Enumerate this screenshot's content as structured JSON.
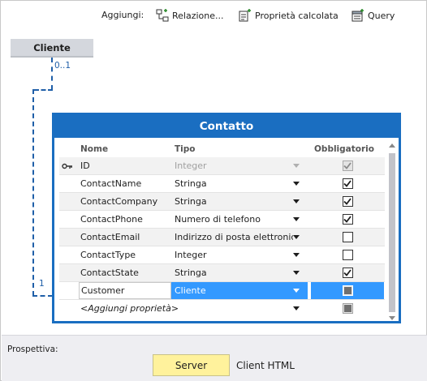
{
  "toolbar": {
    "label": "Aggiungi:",
    "relation_label": "Relazione...",
    "computed_label": "Proprietà calcolata",
    "query_label": "Query"
  },
  "parent_entity": {
    "name": "Cliente",
    "multiplicity_top": "0..1",
    "multiplicity_bottom": "1"
  },
  "entity": {
    "title": "Contatto",
    "columns": {
      "name": "Nome",
      "type": "Tipo",
      "required": "Obbligatorio"
    },
    "rows": [
      {
        "name": "ID",
        "type": "Integer",
        "required": true,
        "key": true,
        "disabled": true
      },
      {
        "name": "ContactName",
        "type": "Stringa",
        "required": true
      },
      {
        "name": "ContactCompany",
        "type": "Stringa",
        "required": true
      },
      {
        "name": "ContactPhone",
        "type": "Numero di telefono",
        "required": true
      },
      {
        "name": "ContactEmail",
        "type": "Indirizzo di posta elettronica",
        "required": false
      },
      {
        "name": "ContactType",
        "type": "Integer",
        "required": false
      },
      {
        "name": "ContactState",
        "type": "Stringa",
        "required": true
      },
      {
        "name": "Customer",
        "type": "Cliente",
        "required": "indeterminate",
        "selected": true
      }
    ],
    "add_property": "<Aggiungi proprietà>"
  },
  "perspective": {
    "label": "Prospettiva:",
    "server_label": "Server",
    "client_label": "Client HTML"
  },
  "colors": {
    "accent": "#1a6ec1",
    "selection": "#3399ff",
    "server_button": "#fff29c"
  }
}
